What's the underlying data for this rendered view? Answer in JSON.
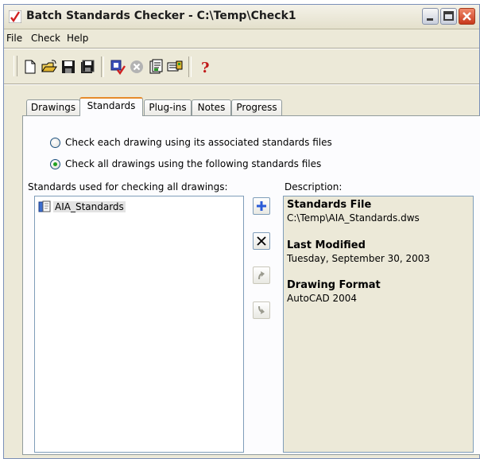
{
  "window": {
    "title": "Batch Standards Checker - C:\\Temp\\Check1"
  },
  "menu": [
    "File",
    "Check",
    "Help"
  ],
  "toolbar": {
    "buttons": [
      "new-icon",
      "open-icon",
      "save-icon",
      "save-as-icon",
      "check-icon",
      "stop-icon",
      "view-report-icon",
      "export-report-icon",
      "help-icon"
    ]
  },
  "tabs": [
    {
      "label": "Drawings",
      "active": false
    },
    {
      "label": "Standards",
      "active": true
    },
    {
      "label": "Plug-ins",
      "active": false
    },
    {
      "label": "Notes",
      "active": false
    },
    {
      "label": "Progress",
      "active": false
    }
  ],
  "options": {
    "option1": "Check each drawing using its associated standards files",
    "option2": "Check all drawings using the following standards files",
    "selected": "option2"
  },
  "standards_list": {
    "label": "Standards used for checking all drawings:",
    "items": [
      "AIA_Standards"
    ]
  },
  "description": {
    "label": "Description:",
    "fields": [
      {
        "heading": "Standards File",
        "value": "C:\\Temp\\AIA_Standards.dws"
      },
      {
        "heading": "Last Modified",
        "value": "Tuesday, September 30, 2003"
      },
      {
        "heading": "Drawing Format",
        "value": "AutoCAD 2004"
      }
    ]
  },
  "colors": {
    "active_tab_accent": "#e68b2c",
    "radio_checked": "#21a121",
    "add_icon": "#2a5bd7"
  }
}
